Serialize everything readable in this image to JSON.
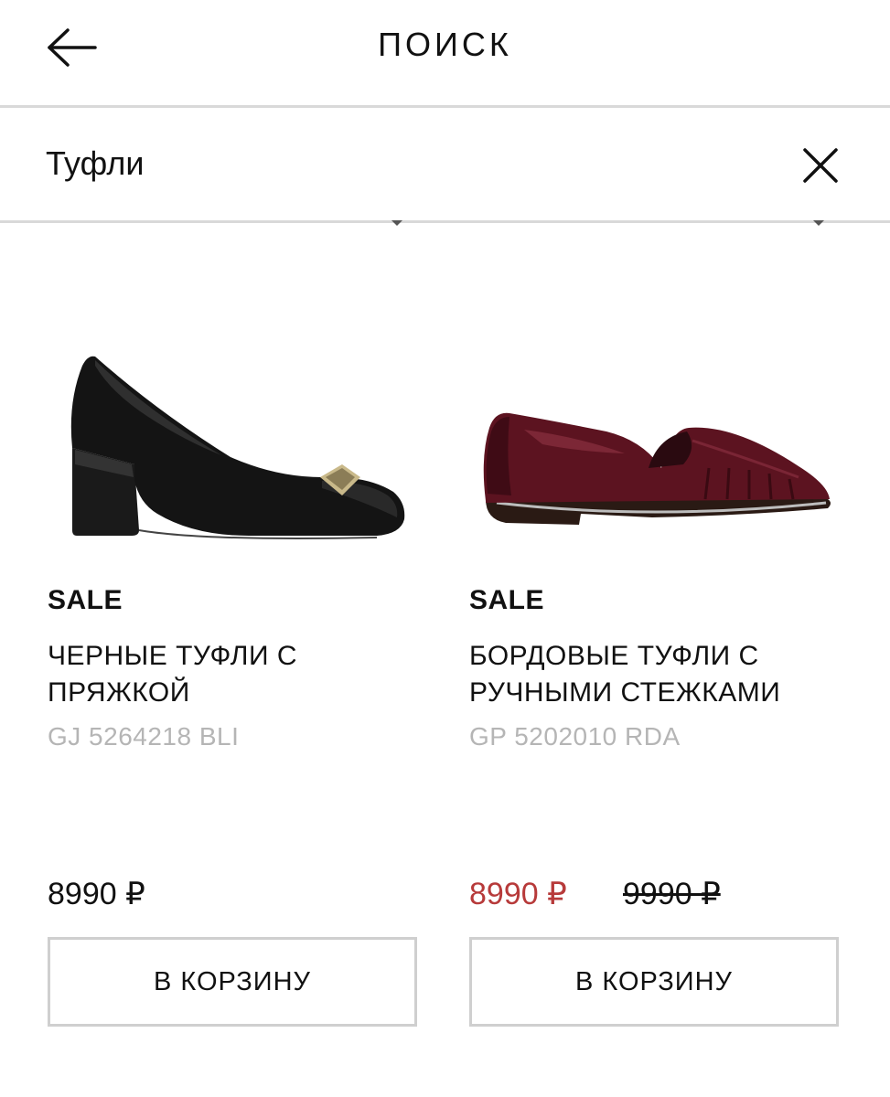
{
  "header": {
    "title": "ПОИСК",
    "back_icon": "arrow-left-icon"
  },
  "search": {
    "value": "Туфли",
    "clear_icon": "close-icon"
  },
  "colors": {
    "text": "#111111",
    "sale_price": "#b73a3a",
    "sku": "#b5b5b5",
    "divider": "#d9d9d9",
    "button_border": "#cfcfcf"
  },
  "products": [
    {
      "badge": "SALE",
      "name": "ЧЕРНЫЕ ТУФЛИ С ПРЯЖКОЙ",
      "sku": "GJ 5264218 BLI",
      "price": "8990 ₽",
      "old_price": "",
      "cart_label": "В КОРЗИНУ",
      "image": "black-pump-shoe"
    },
    {
      "badge": "SALE",
      "name": "БОРДОВЫЕ ТУФЛИ С РУЧНЫМИ СТЕЖКАМИ",
      "sku": "GP 5202010 RDA",
      "price": "8990 ₽",
      "old_price": "9990 ₽",
      "cart_label": "В КОРЗИНУ",
      "image": "burgundy-loafer-shoe"
    }
  ]
}
